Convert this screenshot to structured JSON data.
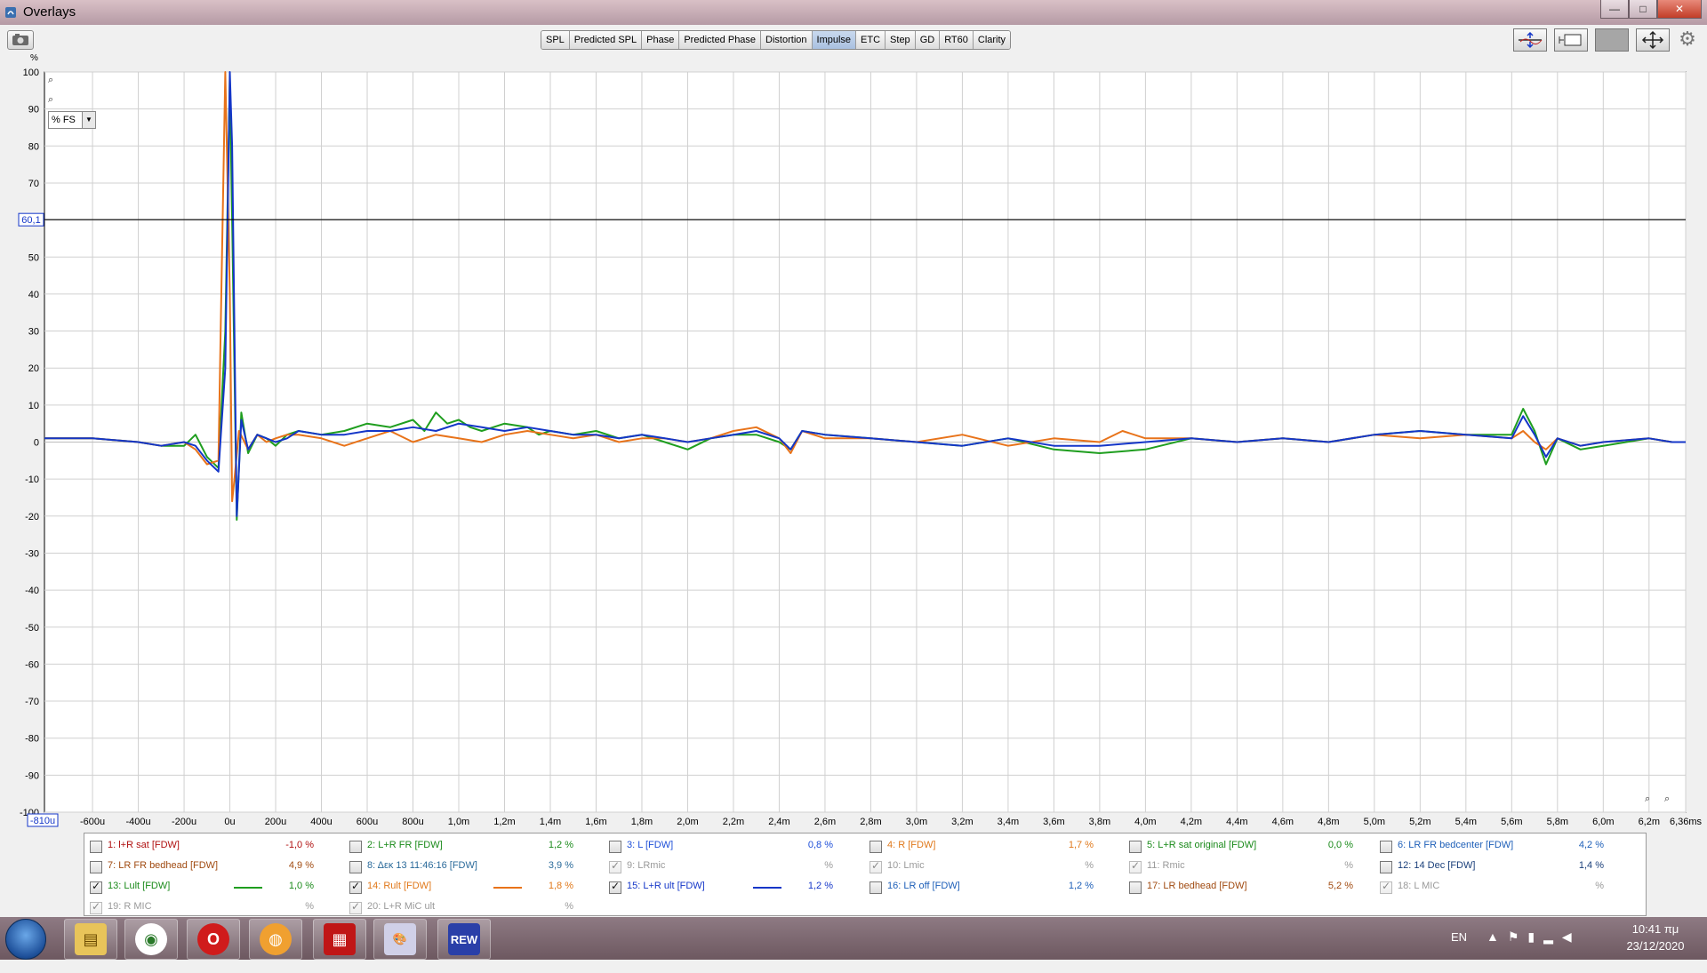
{
  "window": {
    "title": "Overlays",
    "buttons": {
      "minimize": "—",
      "maximize": "□",
      "close": "✕"
    }
  },
  "toolbar": {
    "tabs": [
      {
        "label": "SPL",
        "active": false
      },
      {
        "label": "Predicted SPL",
        "active": false
      },
      {
        "label": "Phase",
        "active": false
      },
      {
        "label": "Predicted Phase",
        "active": false
      },
      {
        "label": "Distortion",
        "active": false
      },
      {
        "label": "Impulse",
        "active": true
      },
      {
        "label": "ETC",
        "active": false
      },
      {
        "label": "Step",
        "active": false
      },
      {
        "label": "GD",
        "active": false
      },
      {
        "label": "RT60",
        "active": false
      },
      {
        "label": "Clarity",
        "active": false
      }
    ]
  },
  "plot": {
    "y_unit": "%",
    "y_mode": "% FS",
    "cursor_y_label": "60,1",
    "cursor_x_label": "-810u"
  },
  "chart_data": {
    "type": "line",
    "ylabel": "%",
    "ylim": [
      -100,
      100
    ],
    "xlim": [
      -0.81,
      6.36
    ],
    "x_unit": "ms",
    "grid": true,
    "y_ticks": [
      "100",
      "90",
      "80",
      "70",
      "60",
      "50",
      "40",
      "30",
      "20",
      "10",
      "0",
      "-10",
      "-20",
      "-30",
      "-40",
      "-50",
      "-60",
      "-70",
      "-80",
      "-90",
      "-100"
    ],
    "x_ticks": [
      {
        "v": -0.6,
        "label": "-600u"
      },
      {
        "v": -0.4,
        "label": "-400u"
      },
      {
        "v": -0.2,
        "label": "-200u"
      },
      {
        "v": 0,
        "label": "0u"
      },
      {
        "v": 0.2,
        "label": "200u"
      },
      {
        "v": 0.4,
        "label": "400u"
      },
      {
        "v": 0.6,
        "label": "600u"
      },
      {
        "v": 0.8,
        "label": "800u"
      },
      {
        "v": 1.0,
        "label": "1,0m"
      },
      {
        "v": 1.2,
        "label": "1,2m"
      },
      {
        "v": 1.4,
        "label": "1,4m"
      },
      {
        "v": 1.6,
        "label": "1,6m"
      },
      {
        "v": 1.8,
        "label": "1,8m"
      },
      {
        "v": 2.0,
        "label": "2,0m"
      },
      {
        "v": 2.2,
        "label": "2,2m"
      },
      {
        "v": 2.4,
        "label": "2,4m"
      },
      {
        "v": 2.6,
        "label": "2,6m"
      },
      {
        "v": 2.8,
        "label": "2,8m"
      },
      {
        "v": 3.0,
        "label": "3,0m"
      },
      {
        "v": 3.2,
        "label": "3,2m"
      },
      {
        "v": 3.4,
        "label": "3,4m"
      },
      {
        "v": 3.6,
        "label": "3,6m"
      },
      {
        "v": 3.8,
        "label": "3,8m"
      },
      {
        "v": 4.0,
        "label": "4,0m"
      },
      {
        "v": 4.2,
        "label": "4,2m"
      },
      {
        "v": 4.4,
        "label": "4,4m"
      },
      {
        "v": 4.6,
        "label": "4,6m"
      },
      {
        "v": 4.8,
        "label": "4,8m"
      },
      {
        "v": 5.0,
        "label": "5,0m"
      },
      {
        "v": 5.2,
        "label": "5,2m"
      },
      {
        "v": 5.4,
        "label": "5,4m"
      },
      {
        "v": 5.6,
        "label": "5,6m"
      },
      {
        "v": 5.8,
        "label": "5,8m"
      },
      {
        "v": 6.0,
        "label": "6,0m"
      },
      {
        "v": 6.2,
        "label": "6,2m"
      },
      {
        "v": 6.36,
        "label": "6,36ms"
      }
    ],
    "cursor_y": 60.1,
    "series": [
      {
        "name": "13: Lult [FDW]",
        "color": "#1f9e1f",
        "x": [
          -0.81,
          -0.6,
          -0.4,
          -0.3,
          -0.2,
          -0.15,
          -0.1,
          -0.05,
          -0.02,
          0.0,
          0.01,
          0.03,
          0.05,
          0.08,
          0.12,
          0.16,
          0.2,
          0.25,
          0.3,
          0.4,
          0.5,
          0.6,
          0.7,
          0.8,
          0.85,
          0.9,
          0.95,
          1.0,
          1.05,
          1.1,
          1.2,
          1.3,
          1.35,
          1.4,
          1.5,
          1.6,
          1.7,
          1.8,
          1.9,
          2.0,
          2.1,
          2.2,
          2.3,
          2.4,
          2.45,
          2.5,
          2.6,
          2.8,
          3.0,
          3.2,
          3.4,
          3.6,
          3.8,
          4.0,
          4.2,
          4.4,
          4.6,
          4.8,
          5.0,
          5.2,
          5.4,
          5.6,
          5.65,
          5.7,
          5.75,
          5.8,
          5.9,
          6.0,
          6.2,
          6.3,
          6.36
        ],
        "y": [
          1,
          1,
          0,
          -1,
          -1,
          2,
          -4,
          -7,
          30,
          98,
          60,
          -21,
          8,
          -3,
          2,
          1,
          -1,
          2,
          3,
          2,
          3,
          5,
          4,
          6,
          3,
          8,
          5,
          6,
          4,
          3,
          5,
          4,
          2,
          3,
          2,
          3,
          1,
          2,
          0,
          -2,
          1,
          2,
          2,
          0,
          -2,
          3,
          2,
          1,
          0,
          -1,
          1,
          -2,
          -3,
          -2,
          1,
          0,
          1,
          0,
          2,
          3,
          2,
          2,
          9,
          3,
          -6,
          1,
          -2,
          -1,
          1,
          0,
          0
        ]
      },
      {
        "name": "14: Rult [FDW]",
        "color": "#e8731a",
        "x": [
          -0.81,
          -0.6,
          -0.4,
          -0.3,
          -0.2,
          -0.15,
          -0.1,
          -0.05,
          -0.04,
          -0.02,
          0.0,
          0.01,
          0.02,
          0.04,
          0.08,
          0.12,
          0.16,
          0.2,
          0.25,
          0.3,
          0.4,
          0.5,
          0.6,
          0.7,
          0.8,
          0.9,
          1.0,
          1.1,
          1.2,
          1.3,
          1.4,
          1.5,
          1.6,
          1.7,
          1.8,
          1.9,
          2.0,
          2.1,
          2.2,
          2.3,
          2.4,
          2.45,
          2.5,
          2.6,
          2.8,
          3.0,
          3.2,
          3.4,
          3.6,
          3.8,
          3.9,
          4.0,
          4.2,
          4.4,
          4.6,
          4.8,
          5.0,
          5.2,
          5.4,
          5.6,
          5.65,
          5.7,
          5.75,
          5.8,
          5.9,
          6.0,
          6.2,
          6.3,
          6.36
        ],
        "y": [
          1,
          1,
          0,
          -1,
          0,
          -2,
          -6,
          -5,
          30,
          100,
          40,
          -16,
          -10,
          3,
          -2,
          2,
          0,
          1,
          2,
          2,
          1,
          -1,
          1,
          3,
          0,
          2,
          1,
          0,
          2,
          3,
          2,
          1,
          2,
          0,
          1,
          1,
          0,
          1,
          3,
          4,
          1,
          -3,
          3,
          1,
          1,
          0,
          2,
          -1,
          1,
          0,
          3,
          1,
          1,
          0,
          1,
          0,
          2,
          1,
          2,
          1,
          3,
          0,
          -2,
          1,
          -1,
          0,
          1,
          0,
          0
        ]
      },
      {
        "name": "15: L+R ult [FDW]",
        "color": "#1436c8",
        "x": [
          -0.81,
          -0.6,
          -0.4,
          -0.3,
          -0.2,
          -0.15,
          -0.1,
          -0.05,
          -0.02,
          0.0,
          0.01,
          0.03,
          0.05,
          0.08,
          0.12,
          0.16,
          0.2,
          0.25,
          0.3,
          0.4,
          0.5,
          0.6,
          0.7,
          0.8,
          0.9,
          1.0,
          1.1,
          1.2,
          1.3,
          1.4,
          1.5,
          1.6,
          1.7,
          1.8,
          1.9,
          2.0,
          2.1,
          2.2,
          2.3,
          2.4,
          2.45,
          2.5,
          2.6,
          2.8,
          3.0,
          3.2,
          3.4,
          3.6,
          3.8,
          4.0,
          4.2,
          4.4,
          4.6,
          4.8,
          5.0,
          5.2,
          5.4,
          5.6,
          5.65,
          5.7,
          5.75,
          5.8,
          5.9,
          6.0,
          6.2,
          6.3,
          6.36
        ],
        "y": [
          1,
          1,
          0,
          -1,
          0,
          -1,
          -5,
          -8,
          20,
          100,
          80,
          -20,
          6,
          -2,
          2,
          1,
          0,
          1,
          3,
          2,
          2,
          3,
          3,
          4,
          3,
          5,
          4,
          3,
          4,
          3,
          2,
          2,
          1,
          2,
          1,
          0,
          1,
          2,
          3,
          1,
          -2,
          3,
          2,
          1,
          0,
          -1,
          1,
          -1,
          -1,
          0,
          1,
          0,
          1,
          0,
          2,
          3,
          2,
          1,
          7,
          2,
          -4,
          1,
          -1,
          0,
          1,
          0,
          0
        ]
      }
    ]
  },
  "legend": {
    "items": [
      {
        "label": "1: l+R sat [FDW]",
        "value": "-1,0 %",
        "checked": false,
        "enabled": true,
        "color": "#b01010",
        "line": ""
      },
      {
        "label": "2: L+R FR [FDW]",
        "value": "1,2 %",
        "checked": false,
        "enabled": true,
        "color": "#1a8a1a",
        "line": ""
      },
      {
        "label": "3: L [FDW]",
        "value": "0,8 %",
        "checked": false,
        "enabled": true,
        "color": "#1e4fd8",
        "line": ""
      },
      {
        "label": "4: R [FDW]",
        "value": "1,7 %",
        "checked": false,
        "enabled": true,
        "color": "#e0781a",
        "line": ""
      },
      {
        "label": "5: L+R sat original [FDW]",
        "value": "0,0 %",
        "checked": false,
        "enabled": true,
        "color": "#1a8a1a",
        "line": ""
      },
      {
        "label": "6: LR FR bedcenter [FDW]",
        "value": "4,2 %",
        "checked": false,
        "enabled": true,
        "color": "#1e5fb8",
        "line": ""
      },
      {
        "label": "7: LR FR bedhead [FDW]",
        "value": "4,9 %",
        "checked": false,
        "enabled": true,
        "color": "#a04a10",
        "line": ""
      },
      {
        "label": "8: Δεκ 13 11:46:16 [FDW]",
        "value": "3,9 %",
        "checked": false,
        "enabled": true,
        "color": "#2a6a9a",
        "line": ""
      },
      {
        "label": "9: LRmic",
        "value": "%",
        "checked": true,
        "enabled": false,
        "color": "#9a9a9a",
        "line": ""
      },
      {
        "label": "10: Lmic",
        "value": "%",
        "checked": true,
        "enabled": false,
        "color": "#9a9a9a",
        "line": ""
      },
      {
        "label": "11: Rmic",
        "value": "%",
        "checked": true,
        "enabled": false,
        "color": "#9a9a9a",
        "line": ""
      },
      {
        "label": "12: 14 Dec [FDW]",
        "value": "1,4 %",
        "checked": false,
        "enabled": true,
        "color": "#1a3f7a",
        "line": ""
      },
      {
        "label": "13: Lult [FDW]",
        "value": "1,0 %",
        "checked": true,
        "enabled": true,
        "color": "#1a8a1a",
        "line": "#1f9e1f"
      },
      {
        "label": "14: Rult [FDW]",
        "value": "1,8 %",
        "checked": true,
        "enabled": true,
        "color": "#e0781a",
        "line": "#e8731a"
      },
      {
        "label": "15: L+R ult [FDW]",
        "value": "1,2 %",
        "checked": true,
        "enabled": true,
        "color": "#1436c8",
        "line": "#1436c8"
      },
      {
        "label": "16: LR off [FDW]",
        "value": "1,2 %",
        "checked": false,
        "enabled": true,
        "color": "#1e5fb8",
        "line": ""
      },
      {
        "label": "17: LR bedhead [FDW]",
        "value": "5,2 %",
        "checked": false,
        "enabled": true,
        "color": "#a04a10",
        "line": ""
      },
      {
        "label": "18: L MIC",
        "value": "%",
        "checked": true,
        "enabled": false,
        "color": "#9a9a9a",
        "line": ""
      },
      {
        "label": "19: R MIC",
        "value": "%",
        "checked": true,
        "enabled": false,
        "color": "#9a9a9a",
        "line": ""
      },
      {
        "label": "20: L+R MiC ult",
        "value": "%",
        "checked": true,
        "enabled": false,
        "color": "#9a9a9a",
        "line": ""
      }
    ]
  },
  "taskbar": {
    "apps": [
      {
        "name": "explorer-icon",
        "label": "▤"
      },
      {
        "name": "chrome-icon",
        "label": "◉"
      },
      {
        "name": "opera-icon",
        "label": "O"
      },
      {
        "name": "browser-icon",
        "label": "◍"
      },
      {
        "name": "app-grid-icon",
        "label": "▦"
      },
      {
        "name": "paint-icon",
        "label": "🎨"
      },
      {
        "name": "rew-icon",
        "label": "REW"
      }
    ],
    "language": "EN",
    "time": "10:41 πμ",
    "date": "23/12/2020"
  }
}
